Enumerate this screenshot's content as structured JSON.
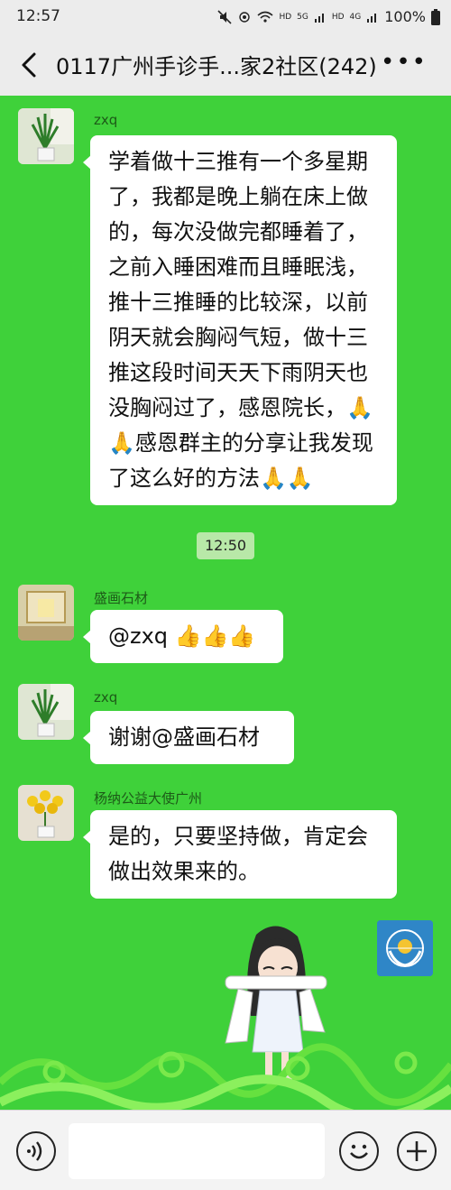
{
  "status": {
    "time": "12:57",
    "hd1": "HD",
    "network1": "5G",
    "hd2": "HD",
    "network2": "4G",
    "battery": "100%"
  },
  "header": {
    "title": "0117广州手诊手...家2社区(242)",
    "more_icon": "more-dots-icon",
    "back_icon": "chevron-left-icon"
  },
  "messages": [
    {
      "sender": "zxq",
      "text": "学着做十三推有一个多星期\n了，我都是晚上躺在床上做\n的，每次没做完都睡着了，\n之前入睡困难而且睡眠浅，\n推十三推睡的比较深，以前\n阴天就会胸闷气短，做十三\n推这段时间天天下雨阴天也\n没胸闷过了，感恩院长，🙏\n🙏感恩群主的分享让我发现\n了这么好的方法🙏🙏"
    },
    {
      "timestamp": "12:50"
    },
    {
      "sender": "盛画石材",
      "text": "@zxq 👍👍👍"
    },
    {
      "sender": "zxq",
      "text": "谢谢@盛画石材"
    },
    {
      "sender": "杨纳公益大使广州",
      "text": "是的，只要坚持做，肯定会\n做出效果来的。"
    }
  ],
  "colors": {
    "chat_background": "#3fd13a",
    "bubble": "#ffffff",
    "header_background": "#ececec"
  }
}
